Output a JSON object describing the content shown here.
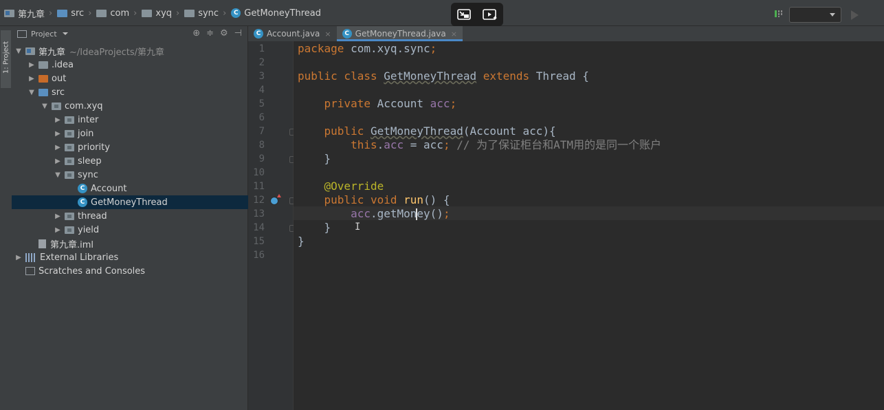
{
  "breadcrumbs": [
    "第九章",
    "src",
    "com",
    "xyq",
    "sync",
    "GetMoneyThread"
  ],
  "project_panel": {
    "title": "Project",
    "tool_strip_label": "1: Project",
    "tree": [
      {
        "label": "第九章",
        "extra": "~/IdeaProjects/第九章",
        "icon": "project-folder-icon",
        "arrow": "expanded",
        "level": 0
      },
      {
        "label": ".idea",
        "icon": "folder-icon",
        "arrow": "collapsed",
        "level": 1
      },
      {
        "label": "out",
        "icon": "folder-orange-icon",
        "arrow": "collapsed",
        "level": 1
      },
      {
        "label": "src",
        "icon": "source-folder-icon",
        "arrow": "expanded",
        "level": 1
      },
      {
        "label": "com.xyq",
        "icon": "package-icon",
        "arrow": "expanded",
        "level": 2
      },
      {
        "label": "inter",
        "icon": "package-icon",
        "arrow": "collapsed",
        "level": 3
      },
      {
        "label": "join",
        "icon": "package-icon",
        "arrow": "collapsed",
        "level": 3
      },
      {
        "label": "priority",
        "icon": "package-icon",
        "arrow": "collapsed",
        "level": 3
      },
      {
        "label": "sleep",
        "icon": "package-icon",
        "arrow": "collapsed",
        "level": 3
      },
      {
        "label": "sync",
        "icon": "package-icon",
        "arrow": "expanded",
        "level": 3
      },
      {
        "label": "Account",
        "icon": "class-icon",
        "arrow": "none",
        "level": 4
      },
      {
        "label": "GetMoneyThread",
        "icon": "class-icon",
        "arrow": "none",
        "level": 4,
        "selected": true
      },
      {
        "label": "thread",
        "icon": "package-icon",
        "arrow": "collapsed",
        "level": 3
      },
      {
        "label": "yield",
        "icon": "package-icon",
        "arrow": "collapsed",
        "level": 3
      },
      {
        "label": "第九章.iml",
        "icon": "file-icon",
        "arrow": "none",
        "level": 1
      },
      {
        "label": "External Libraries",
        "icon": "library-icon",
        "arrow": "collapsed",
        "level": 0
      },
      {
        "label": "Scratches and Consoles",
        "icon": "scratch-icon",
        "arrow": "none",
        "level": 0
      }
    ]
  },
  "tabs": [
    {
      "label": "Account.java",
      "active": false
    },
    {
      "label": "GetMoneyThread.java",
      "active": true
    }
  ],
  "editor": {
    "line_numbers": [
      "1",
      "2",
      "3",
      "4",
      "5",
      "6",
      "7",
      "8",
      "9",
      "10",
      "11",
      "12",
      "13",
      "14",
      "15",
      "16"
    ],
    "lines": [
      {
        "n": "1",
        "tokens": [
          [
            "kw",
            "package "
          ],
          [
            "txt",
            "com.xyq.sync"
          ],
          [
            "kw",
            ";"
          ]
        ]
      },
      {
        "n": "2",
        "tokens": []
      },
      {
        "n": "3",
        "tokens": [
          [
            "kw",
            "public class "
          ],
          [
            "clsul",
            "GetMoneyThread"
          ],
          [
            "kw",
            " extends "
          ],
          [
            "txt",
            "Thread {"
          ]
        ]
      },
      {
        "n": "4",
        "tokens": []
      },
      {
        "n": "5",
        "tokens": [
          [
            "txt",
            "    "
          ],
          [
            "kw",
            "private "
          ],
          [
            "txt",
            "Account "
          ],
          [
            "fld",
            "acc"
          ],
          [
            "kw",
            ";"
          ]
        ]
      },
      {
        "n": "6",
        "tokens": []
      },
      {
        "n": "7",
        "tokens": [
          [
            "txt",
            "    "
          ],
          [
            "kw",
            "public "
          ],
          [
            "clsul",
            "GetMoneyThread"
          ],
          [
            "txt",
            "(Account acc){"
          ]
        ]
      },
      {
        "n": "8",
        "tokens": [
          [
            "txt",
            "        "
          ],
          [
            "kw",
            "this"
          ],
          [
            "txt",
            "."
          ],
          [
            "fld",
            "acc"
          ],
          [
            "txt",
            " = acc"
          ],
          [
            "kw",
            ";"
          ],
          [
            "cmt",
            " // 为了保证柜台和ATM用的是同一个账户"
          ]
        ]
      },
      {
        "n": "9",
        "tokens": [
          [
            "txt",
            "    }"
          ]
        ]
      },
      {
        "n": "10",
        "tokens": []
      },
      {
        "n": "11",
        "tokens": [
          [
            "txt",
            "    "
          ],
          [
            "ann",
            "@Override"
          ]
        ]
      },
      {
        "n": "12",
        "tokens": [
          [
            "txt",
            "    "
          ],
          [
            "kw",
            "public void "
          ],
          [
            "fn",
            "run"
          ],
          [
            "txt",
            "() {"
          ]
        ]
      },
      {
        "n": "13",
        "tokens": [
          [
            "txt",
            "        "
          ],
          [
            "fld",
            "acc"
          ],
          [
            "txt",
            ".getMon"
          ],
          [
            "caret",
            ""
          ],
          [
            "txt",
            "ey()"
          ],
          [
            "kw",
            ";"
          ]
        ]
      },
      {
        "n": "14",
        "tokens": [
          [
            "txt",
            "    }"
          ]
        ]
      },
      {
        "n": "15",
        "tokens": [
          [
            "txt",
            "}"
          ]
        ]
      },
      {
        "n": "16",
        "tokens": []
      }
    ]
  },
  "colors": {
    "keyword": "#cc7832",
    "field": "#9876aa",
    "method": "#ffc66d",
    "annotation": "#bbb529",
    "comment": "#808080",
    "text": "#a9b7c6",
    "selection": "#0d293e",
    "tab_accent": "#4a88c7"
  }
}
